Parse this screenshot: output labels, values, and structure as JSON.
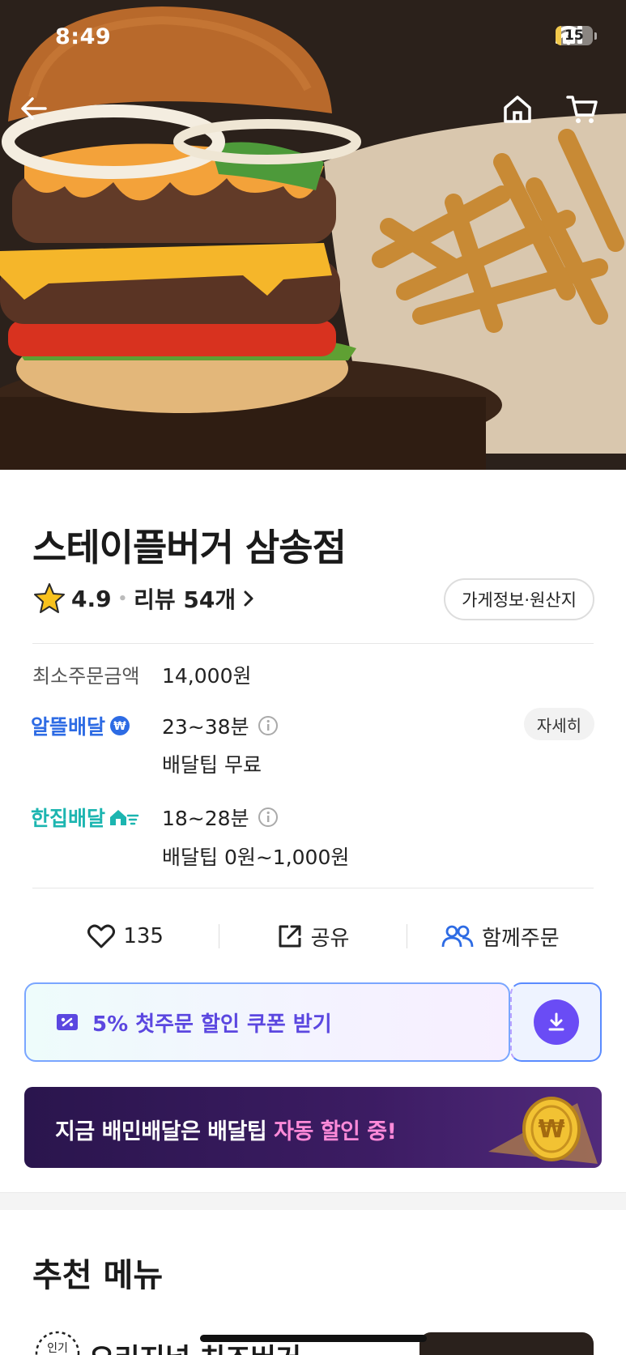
{
  "status_bar": {
    "time": "8:49",
    "battery": "15",
    "battery_level": 0.15
  },
  "store": {
    "name": "스테이플버거 삼송점",
    "rating": "4.9",
    "review_label": "리뷰 54개",
    "info_button": "가게정보·원산지"
  },
  "order_info": {
    "min_order_label": "최소주문금액",
    "min_order_value": "14,000원",
    "delivery_a": {
      "brand": "알뜰배달",
      "time": "23~38분",
      "tip": "배달팁 무료"
    },
    "delivery_b": {
      "brand": "한집배달",
      "time": "18~28분",
      "tip": "배달팁 0원~1,000원"
    },
    "detail_button": "자세히"
  },
  "actions": {
    "likes": "135",
    "share": "공유",
    "group_order": "함께주문"
  },
  "coupon": {
    "label": "5% 첫주문 할인 쿠폰 받기"
  },
  "banner": {
    "text_main": "지금 배민배달은 배달팁 ",
    "text_highlight": "자동 할인 중!"
  },
  "section": {
    "title": "추천 메뉴"
  },
  "menu_peek": {
    "name": "오리지널 치즈버거",
    "badge": "인기"
  },
  "colors": {
    "accent_blue": "#2d6be4",
    "accent_teal": "#1cb5b0",
    "coupon_purple": "#5b47e0",
    "banner_bg": "#2a154d"
  }
}
